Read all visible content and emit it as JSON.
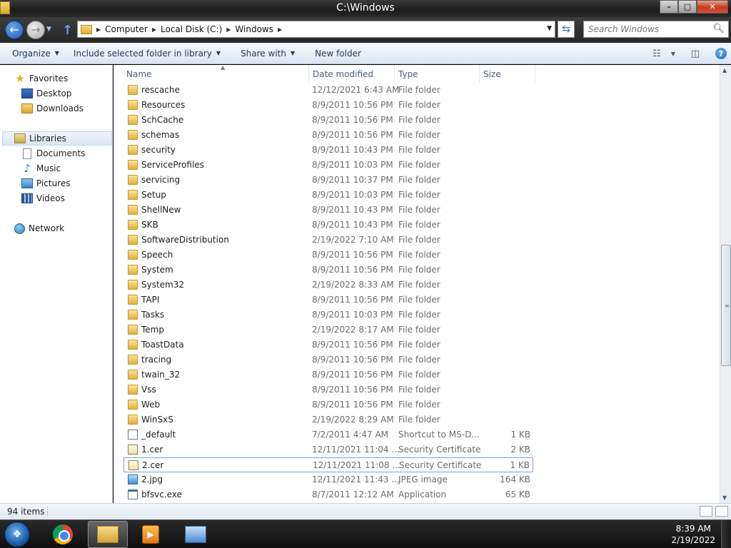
{
  "window": {
    "title": "C:\\Windows",
    "controls": {
      "minimize": "–",
      "maximize": "□",
      "close": "✕"
    }
  },
  "address": {
    "breadcrumbs": [
      "Computer",
      "Local Disk (C:)",
      "Windows"
    ],
    "search_placeholder": "Search Windows"
  },
  "toolbar": {
    "buttons": [
      "Organize",
      "Include selected folder in library",
      "Share with",
      "New folder"
    ]
  },
  "navigation": {
    "favorites": {
      "label": "Favorites",
      "items": [
        "Desktop",
        "Downloads"
      ]
    },
    "libraries": {
      "label": "Libraries",
      "items": [
        "Documents",
        "Music",
        "Pictures",
        "Videos"
      ]
    },
    "network": {
      "label": "Network"
    }
  },
  "columns": [
    "Name",
    "Date modified",
    "Type",
    "Size"
  ],
  "files": [
    {
      "name": "rescache",
      "date": "12/12/2021 6:43 AM",
      "type": "File folder",
      "size": "",
      "icon": "folder"
    },
    {
      "name": "Resources",
      "date": "8/9/2011 10:56 PM",
      "type": "File folder",
      "size": "",
      "icon": "folder"
    },
    {
      "name": "SchCache",
      "date": "8/9/2011 10:56 PM",
      "type": "File folder",
      "size": "",
      "icon": "folder"
    },
    {
      "name": "schemas",
      "date": "8/9/2011 10:56 PM",
      "type": "File folder",
      "size": "",
      "icon": "folder"
    },
    {
      "name": "security",
      "date": "8/9/2011 10:43 PM",
      "type": "File folder",
      "size": "",
      "icon": "folder"
    },
    {
      "name": "ServiceProfiles",
      "date": "8/9/2011 10:03 PM",
      "type": "File folder",
      "size": "",
      "icon": "folder"
    },
    {
      "name": "servicing",
      "date": "8/9/2011 10:37 PM",
      "type": "File folder",
      "size": "",
      "icon": "folder"
    },
    {
      "name": "Setup",
      "date": "8/9/2011 10:03 PM",
      "type": "File folder",
      "size": "",
      "icon": "folder"
    },
    {
      "name": "ShellNew",
      "date": "8/9/2011 10:43 PM",
      "type": "File folder",
      "size": "",
      "icon": "folder"
    },
    {
      "name": "SKB",
      "date": "8/9/2011 10:43 PM",
      "type": "File folder",
      "size": "",
      "icon": "folder"
    },
    {
      "name": "SoftwareDistribution",
      "date": "2/19/2022 7:10 AM",
      "type": "File folder",
      "size": "",
      "icon": "folder"
    },
    {
      "name": "Speech",
      "date": "8/9/2011 10:56 PM",
      "type": "File folder",
      "size": "",
      "icon": "folder"
    },
    {
      "name": "System",
      "date": "8/9/2011 10:56 PM",
      "type": "File folder",
      "size": "",
      "icon": "folder"
    },
    {
      "name": "System32",
      "date": "2/19/2022 8:33 AM",
      "type": "File folder",
      "size": "",
      "icon": "folder"
    },
    {
      "name": "TAPI",
      "date": "8/9/2011 10:56 PM",
      "type": "File folder",
      "size": "",
      "icon": "folder"
    },
    {
      "name": "Tasks",
      "date": "8/9/2011 10:03 PM",
      "type": "File folder",
      "size": "",
      "icon": "folder"
    },
    {
      "name": "Temp",
      "date": "2/19/2022 8:17 AM",
      "type": "File folder",
      "size": "",
      "icon": "folder"
    },
    {
      "name": "ToastData",
      "date": "8/9/2011 10:56 PM",
      "type": "File folder",
      "size": "",
      "icon": "folder"
    },
    {
      "name": "tracing",
      "date": "8/9/2011 10:56 PM",
      "type": "File folder",
      "size": "",
      "icon": "folder"
    },
    {
      "name": "twain_32",
      "date": "8/9/2011 10:56 PM",
      "type": "File folder",
      "size": "",
      "icon": "folder"
    },
    {
      "name": "Vss",
      "date": "8/9/2011 10:56 PM",
      "type": "File folder",
      "size": "",
      "icon": "folder"
    },
    {
      "name": "Web",
      "date": "8/9/2011 10:56 PM",
      "type": "File folder",
      "size": "",
      "icon": "folder"
    },
    {
      "name": "WinSxS",
      "date": "2/19/2022 8:29 AM",
      "type": "File folder",
      "size": "",
      "icon": "folder"
    },
    {
      "name": "_default",
      "date": "7/2/2011 4:47 AM",
      "type": "Shortcut to MS-D...",
      "size": "1 KB",
      "icon": "shortcut"
    },
    {
      "name": "1.cer",
      "date": "12/11/2021 11:04 ...",
      "type": "Security Certificate",
      "size": "2 KB",
      "icon": "certificate"
    },
    {
      "name": "2.cer",
      "date": "12/11/2021 11:08 ...",
      "type": "Security Certificate",
      "size": "1 KB",
      "icon": "certificate",
      "hover": true
    },
    {
      "name": "2.jpg",
      "date": "12/11/2021 11:43 ...",
      "type": "JPEG image",
      "size": "164 KB",
      "icon": "image"
    },
    {
      "name": "bfsvc.exe",
      "date": "8/7/2011 12:12 AM",
      "type": "Application",
      "size": "65 KB",
      "icon": "application"
    }
  ],
  "status": {
    "item_count": "94 items"
  },
  "taskbar": {
    "time": "8:39 AM",
    "date": "2/19/2022"
  }
}
